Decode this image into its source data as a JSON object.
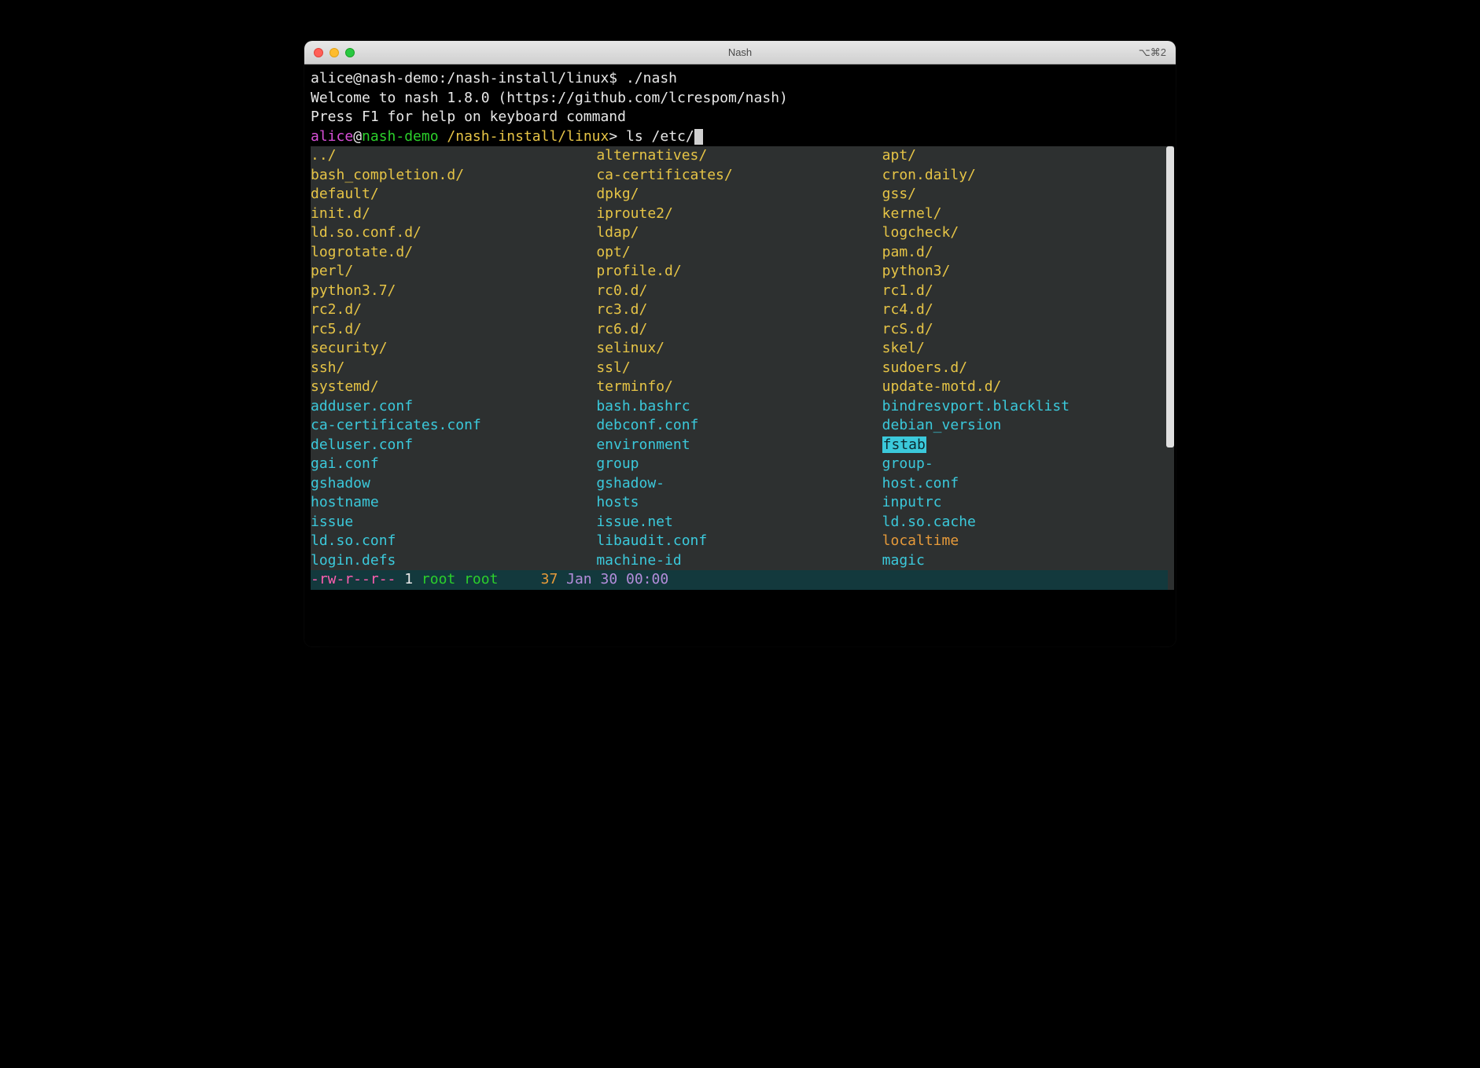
{
  "window": {
    "title": "Nash",
    "shortcut": "⌥⌘2"
  },
  "header": {
    "line1": "alice@nash-demo:/nash-install/linux$ ./nash",
    "line2": "Welcome to nash 1.8.0 (https://github.com/lcrespom/nash)",
    "line3": "Press F1 for help on keyboard command"
  },
  "prompt": {
    "user": "alice",
    "at": "@",
    "host": "nash-demo",
    "sep": " ",
    "path": "/nash-install/linux",
    "gt": ">",
    "cmd": " ls /etc/"
  },
  "rows": [
    {
      "c0": {
        "t": "../",
        "cls": "yellow"
      },
      "c1": {
        "t": "alternatives/",
        "cls": "yellow"
      },
      "c2": {
        "t": "apt/",
        "cls": "yellow"
      }
    },
    {
      "c0": {
        "t": "bash_completion.d/",
        "cls": "yellow"
      },
      "c1": {
        "t": "ca-certificates/",
        "cls": "yellow"
      },
      "c2": {
        "t": "cron.daily/",
        "cls": "yellow"
      }
    },
    {
      "c0": {
        "t": "default/",
        "cls": "yellow"
      },
      "c1": {
        "t": "dpkg/",
        "cls": "yellow"
      },
      "c2": {
        "t": "gss/",
        "cls": "yellow"
      }
    },
    {
      "c0": {
        "t": "init.d/",
        "cls": "yellow"
      },
      "c1": {
        "t": "iproute2/",
        "cls": "yellow"
      },
      "c2": {
        "t": "kernel/",
        "cls": "yellow"
      }
    },
    {
      "c0": {
        "t": "ld.so.conf.d/",
        "cls": "yellow"
      },
      "c1": {
        "t": "ldap/",
        "cls": "yellow"
      },
      "c2": {
        "t": "logcheck/",
        "cls": "yellow"
      }
    },
    {
      "c0": {
        "t": "logrotate.d/",
        "cls": "yellow"
      },
      "c1": {
        "t": "opt/",
        "cls": "yellow"
      },
      "c2": {
        "t": "pam.d/",
        "cls": "yellow"
      }
    },
    {
      "c0": {
        "t": "perl/",
        "cls": "yellow"
      },
      "c1": {
        "t": "profile.d/",
        "cls": "yellow"
      },
      "c2": {
        "t": "python3/",
        "cls": "yellow"
      }
    },
    {
      "c0": {
        "t": "python3.7/",
        "cls": "yellow"
      },
      "c1": {
        "t": "rc0.d/",
        "cls": "yellow"
      },
      "c2": {
        "t": "rc1.d/",
        "cls": "yellow"
      }
    },
    {
      "c0": {
        "t": "rc2.d/",
        "cls": "yellow"
      },
      "c1": {
        "t": "rc3.d/",
        "cls": "yellow"
      },
      "c2": {
        "t": "rc4.d/",
        "cls": "yellow"
      }
    },
    {
      "c0": {
        "t": "rc5.d/",
        "cls": "yellow"
      },
      "c1": {
        "t": "rc6.d/",
        "cls": "yellow"
      },
      "c2": {
        "t": "rcS.d/",
        "cls": "yellow"
      }
    },
    {
      "c0": {
        "t": "security/",
        "cls": "yellow"
      },
      "c1": {
        "t": "selinux/",
        "cls": "yellow"
      },
      "c2": {
        "t": "skel/",
        "cls": "yellow"
      }
    },
    {
      "c0": {
        "t": "ssh/",
        "cls": "yellow"
      },
      "c1": {
        "t": "ssl/",
        "cls": "yellow"
      },
      "c2": {
        "t": "sudoers.d/",
        "cls": "yellow"
      }
    },
    {
      "c0": {
        "t": "systemd/",
        "cls": "yellow"
      },
      "c1": {
        "t": "terminfo/",
        "cls": "yellow"
      },
      "c2": {
        "t": "update-motd.d/",
        "cls": "yellow"
      }
    },
    {
      "c0": {
        "t": "adduser.conf",
        "cls": "cyan"
      },
      "c1": {
        "t": "bash.bashrc",
        "cls": "cyan"
      },
      "c2": {
        "t": "bindresvport.blacklist",
        "cls": "cyan"
      }
    },
    {
      "c0": {
        "t": "ca-certificates.conf",
        "cls": "cyan"
      },
      "c1": {
        "t": "debconf.conf",
        "cls": "cyan"
      },
      "c2": {
        "t": "debian_version",
        "cls": "cyan"
      }
    },
    {
      "c0": {
        "t": "deluser.conf",
        "cls": "cyan"
      },
      "c1": {
        "t": "environment",
        "cls": "cyan"
      },
      "c2": {
        "t": "fstab",
        "cls": "cyan",
        "sel": true
      }
    },
    {
      "c0": {
        "t": "gai.conf",
        "cls": "cyan"
      },
      "c1": {
        "t": "group",
        "cls": "cyan"
      },
      "c2": {
        "t": "group-",
        "cls": "cyan"
      }
    },
    {
      "c0": {
        "t": "gshadow",
        "cls": "cyan"
      },
      "c1": {
        "t": "gshadow-",
        "cls": "cyan"
      },
      "c2": {
        "t": "host.conf",
        "cls": "cyan"
      }
    },
    {
      "c0": {
        "t": "hostname",
        "cls": "cyan"
      },
      "c1": {
        "t": "hosts",
        "cls": "cyan"
      },
      "c2": {
        "t": "inputrc",
        "cls": "cyan"
      }
    },
    {
      "c0": {
        "t": "issue",
        "cls": "cyan"
      },
      "c1": {
        "t": "issue.net",
        "cls": "cyan"
      },
      "c2": {
        "t": "ld.so.cache",
        "cls": "cyan"
      }
    },
    {
      "c0": {
        "t": "ld.so.conf",
        "cls": "cyan"
      },
      "c1": {
        "t": "libaudit.conf",
        "cls": "cyan"
      },
      "c2": {
        "t": "localtime",
        "cls": "orange"
      }
    },
    {
      "c0": {
        "t": "login.defs",
        "cls": "cyan"
      },
      "c1": {
        "t": "machine-id",
        "cls": "cyan"
      },
      "c2": {
        "t": "magic",
        "cls": "cyan"
      }
    }
  ],
  "status": {
    "perms": "-rw-r--r--",
    "links": " 1 ",
    "owner": "root",
    "group": " root",
    "size": "     37",
    "date": " Jan 30 00:00"
  }
}
